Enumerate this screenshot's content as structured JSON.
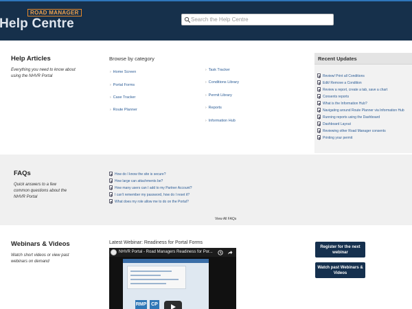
{
  "header": {
    "brand_badge": "ROAD MANAGER",
    "title": "Help Centre",
    "search_placeholder": "Search the Help Centre",
    "background_color": "#16304b"
  },
  "articles": {
    "title": "Help Articles",
    "description": "Everything you need to know about using the NHVR Portal",
    "browse_title": "Browse by category",
    "categories_left": [
      "Home Screen",
      "Portal Forms",
      "Case Tracker",
      "Route Planner"
    ],
    "categories_right": [
      "Task Tracker",
      "Conditions Library",
      "Permit Library",
      "Reports",
      "Information Hub"
    ]
  },
  "updates": {
    "title": "Recent Updates",
    "items": [
      "Review/ Print all Conditions",
      "Edit/ Remove a Condition",
      "Review a report, create a tab, save a chart",
      "Consents reports",
      "What is the Information Hub?",
      "Navigating around Route Planner via Information Hub",
      "Running reports using the Dashboard",
      "Dashboard Layout",
      "Reviewing other Road Manager consents",
      "Printing your permit"
    ]
  },
  "faqs": {
    "title": "FAQs",
    "description": "Quick answers to a few common questions about the NHVR Portal",
    "items": [
      "How do I know the site is secure?",
      "How large can attachments be?",
      "How many users can I add to my Partner Account?",
      "I can't remember my password, how do I reset it?",
      "What does my role allow me to do on the Portal?"
    ],
    "view_all": "View All FAQs"
  },
  "webinars": {
    "title": "Webinars & Videos",
    "description": "Watch short videos or view past webinars on demand",
    "latest_title": "Latest Webinar: Readiness for Portal Forms",
    "video_title": "NHVR Portal - Road Managers Readiness for Por...",
    "video_badges": [
      "RMP",
      "CP"
    ],
    "register_button": "Register for the next webinar",
    "past_button": "Watch past Webinars & Videos"
  }
}
